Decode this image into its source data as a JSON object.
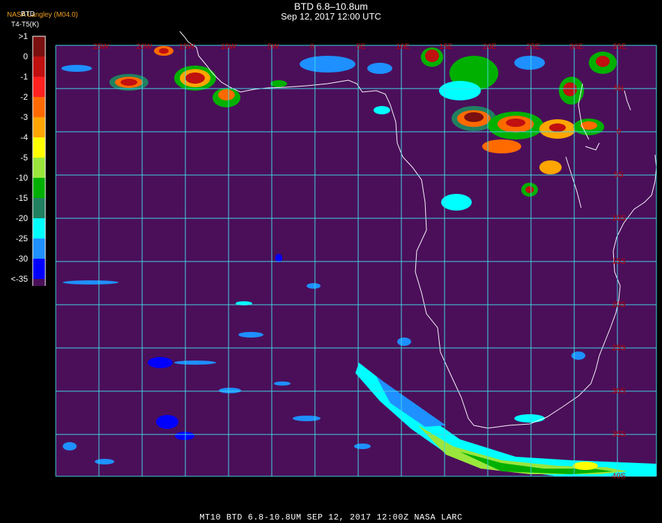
{
  "header": {
    "title": "BTD 6.8–10.8um",
    "subtitle": "Sep 12, 2017 12:00 UTC",
    "credit": "NASA Langley (M04.0)"
  },
  "colorbar": {
    "title_line1": "BTD",
    "title_line2": "T4-T5(K)",
    "labels": [
      ">1",
      "0",
      "-1",
      "-2",
      "-3",
      "-4",
      "-5",
      "-10",
      "-15",
      "-20",
      "-25",
      "-30",
      "<-35"
    ],
    "colors": [
      "#7a1010",
      "#c01010",
      "#ff2020",
      "#ff6a00",
      "#ffa500",
      "#ffff00",
      "#9ae63c",
      "#00b000",
      "#208060",
      "#00ffff",
      "#1e90ff",
      "#0000ff",
      "#4b0f5a"
    ]
  },
  "map": {
    "background_color": "#4b0f5a",
    "grid_color": "#40d8e8",
    "coast_color": "#ffffff",
    "label_color": "#c00000",
    "lon_labels": [
      "25W",
      "20W",
      "15W",
      "10W",
      "5W",
      "0",
      "5E",
      "10E",
      "15E",
      "20E",
      "25E",
      "30E",
      "35E"
    ],
    "lat_labels": [
      "5N",
      "0",
      "5S",
      "10S",
      "15S",
      "20S",
      "25S",
      "30S",
      "35S",
      "40S"
    ]
  },
  "footer": {
    "text": "MT10  BTD 6.8-10.8UM   SEP 12, 2017 12:00Z  NASA LARC"
  }
}
